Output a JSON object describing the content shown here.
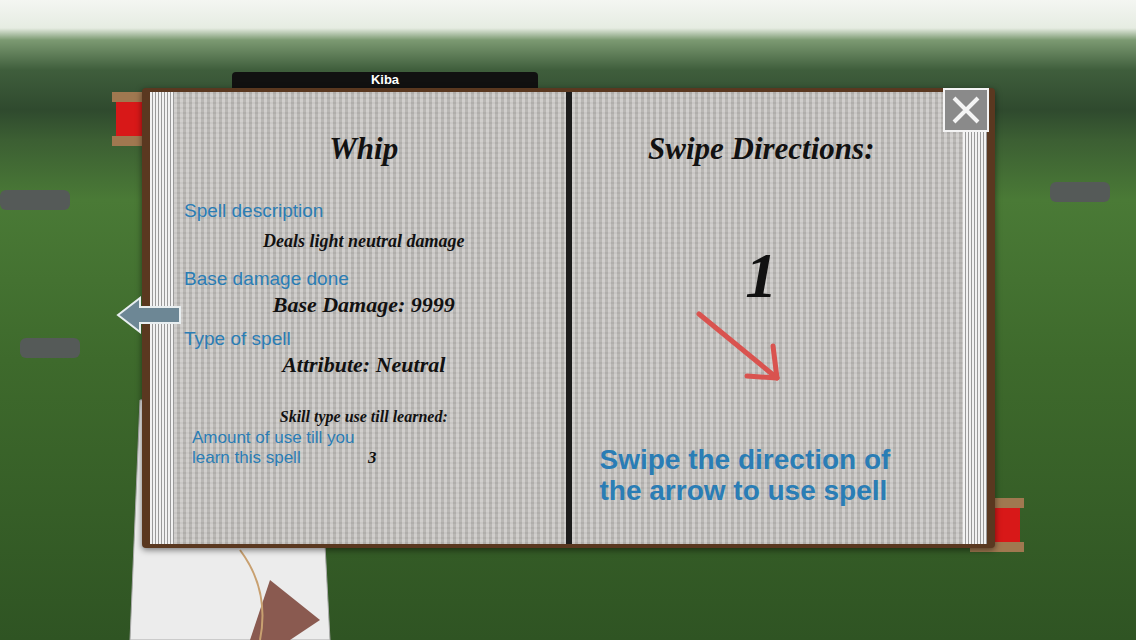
{
  "tab_label": "Kiba",
  "spell": {
    "name": "Whip",
    "fields": [
      {
        "label": "Spell description",
        "value": "Deals light neutral damage"
      },
      {
        "label": "Base damage done",
        "value": "Base Damage: 9999"
      },
      {
        "label": "Type of spell",
        "value": "Attribute: Neutral"
      }
    ],
    "learning": {
      "heading": "Skill type use till learned:",
      "label": "Amount of use till you learn this spell",
      "value": "3"
    }
  },
  "swipe": {
    "title": "Swipe Directions:",
    "steps": [
      {
        "number": "1"
      }
    ],
    "instruction": "Swipe the direction of the arrow to use spell"
  }
}
